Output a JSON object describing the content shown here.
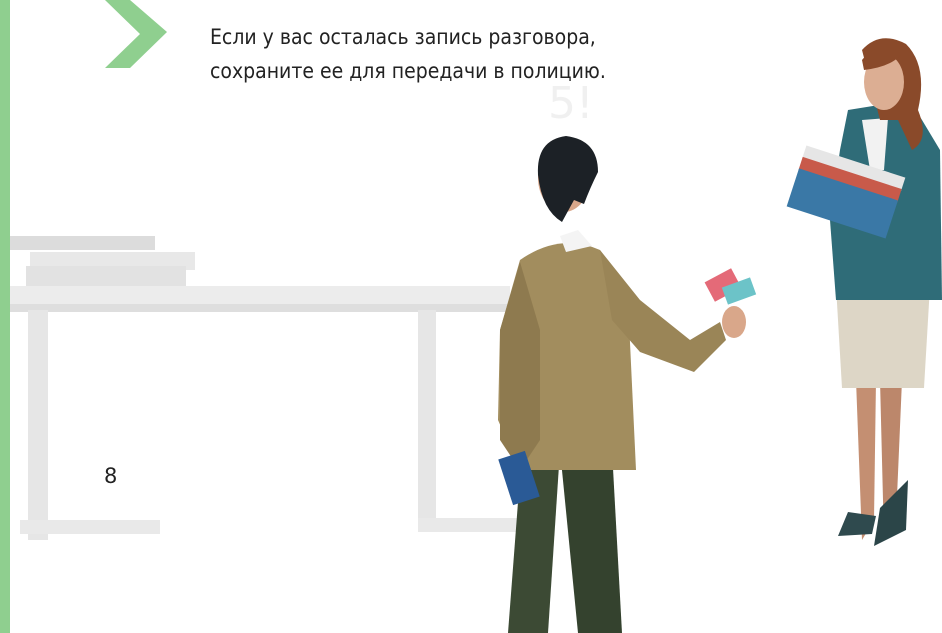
{
  "colors": {
    "accent": "#8fcf8f",
    "text": "#222222",
    "table": "#e6e6e6"
  },
  "caption": {
    "line1": "Если у вас осталась запись разговора,",
    "line2": "сохраните ее для передачи в полицию."
  },
  "page_number": "8",
  "icons": [
    "chevron-right-icon"
  ]
}
